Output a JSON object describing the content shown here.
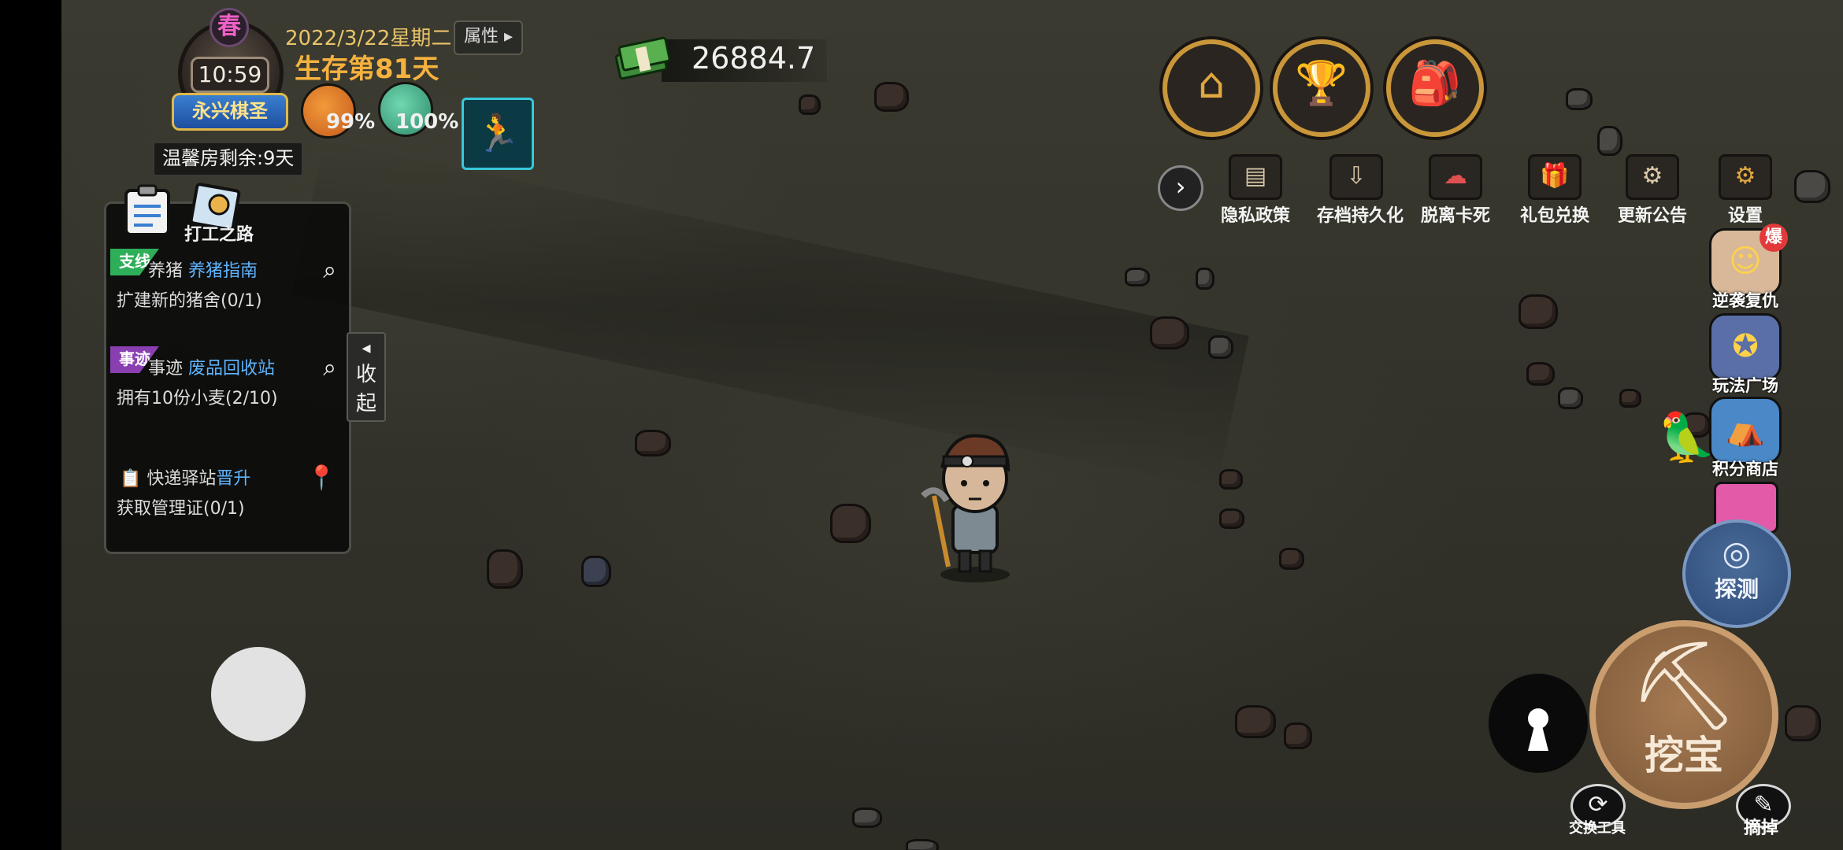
{
  "status": {
    "season": "春",
    "time": "10:59",
    "title_badge": "永兴棋圣",
    "date": "2022/3/22星期二",
    "survival": "生存第81天",
    "attributes_label": "属性",
    "hunger": "99%",
    "health": "100%",
    "greenhouse": "温馨房剩余:9天"
  },
  "money": {
    "value": "26884.7"
  },
  "quests": {
    "tab_label": "打工之路",
    "items": [
      {
        "tag": "支线",
        "tag_color": "#2fae5a",
        "prefix": "养猪",
        "highlight": "养猪指南",
        "detail": "扩建新的猪舍(0/1)",
        "action_icon": "search-icon"
      },
      {
        "tag": "事迹",
        "tag_color": "#8a3fb0",
        "prefix": "事迹",
        "highlight": "废品回收站",
        "detail": "拥有10份小麦(2/10)",
        "action_icon": "search-icon"
      },
      {
        "tag": "",
        "tag_color": "",
        "prefix": "快递驿站",
        "highlight": "晋升",
        "detail": "获取管理证(0/1)",
        "action_icon": "location-pin-icon"
      }
    ],
    "collapse_label": [
      "收",
      "起"
    ]
  },
  "top_icons": [
    "map-icon",
    "trophy-icon",
    "backpack-icon"
  ],
  "menu": [
    {
      "label": "隐私政策",
      "icon": "document-icon"
    },
    {
      "label": "存档持久化",
      "icon": "save-icon"
    },
    {
      "label": "脱离卡死",
      "icon": "unstuck-icon"
    },
    {
      "label": "礼包兑换",
      "icon": "gift-icon"
    },
    {
      "label": "更新公告",
      "icon": "announcement-icon"
    },
    {
      "label": "设置",
      "icon": "gear-icon"
    }
  ],
  "side": [
    {
      "label": "逆袭复仇",
      "icon": "avatar-icon",
      "badge": "爆"
    },
    {
      "label": "玩法广场",
      "icon": "compass-icon"
    },
    {
      "label": "积分商店",
      "icon": "shop-icon"
    }
  ],
  "actions": {
    "probe": "探测",
    "dig": "挖宝",
    "swap_tool": "交换工具",
    "remove": "摘掉"
  }
}
